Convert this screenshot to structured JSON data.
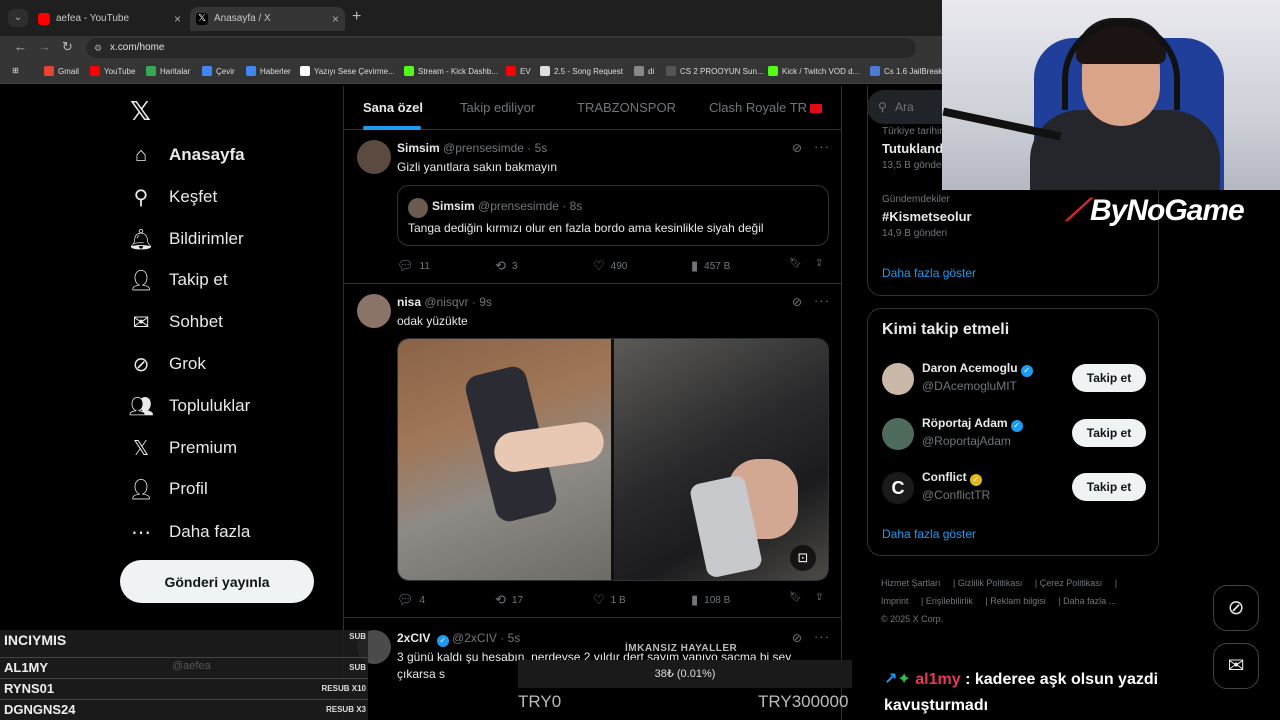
{
  "browser": {
    "tabs": [
      {
        "title": "aefea - YouTube"
      },
      {
        "title": "Anasayfa / X"
      }
    ],
    "url": "x.com/home",
    "bookmarks": [
      "Gmail",
      "YouTube",
      "Haritalar",
      "Çevir",
      "Haberler",
      "Yazıyı Sese Çevirme...",
      "Stream - Kick Dashb...",
      "EV",
      "2.5 - Song Request",
      "di",
      "CS 2 PROOYUN Sun...",
      "Kick / Twitch VOD d...",
      "Cs 1.6 JailBreak"
    ]
  },
  "nav": {
    "items": [
      {
        "label": "Anasayfa",
        "icon": "home-icon"
      },
      {
        "label": "Keşfet",
        "icon": "search-icon"
      },
      {
        "label": "Bildirimler",
        "icon": "bell-icon"
      },
      {
        "label": "Takip et",
        "icon": "add-person-icon"
      },
      {
        "label": "Sohbet",
        "icon": "mail-icon"
      },
      {
        "label": "Grok",
        "icon": "grok-icon"
      },
      {
        "label": "Topluluklar",
        "icon": "communities-icon"
      },
      {
        "label": "Premium",
        "icon": "x-icon"
      },
      {
        "label": "Profil",
        "icon": "person-icon"
      },
      {
        "label": "Daha fazla",
        "icon": "more-circle-icon"
      }
    ],
    "post_button": "Gönderi yayınla"
  },
  "timeline": {
    "tabs": [
      "Sana özel",
      "Takip ediliyor",
      "TRABZONSPOR",
      "Clash Royale TR"
    ],
    "posts": [
      {
        "name": "Simsim",
        "handle": "@prensesimde",
        "time": "5s",
        "text": "Gizli yanıtlara sakın bakmayın",
        "quote": {
          "name": "Simsim",
          "handle": "@prensesimde",
          "time": "8s",
          "text": "Tanga dediğin kırmızı olur en fazla bordo ama kesinlikle siyah değil"
        },
        "replies": "11",
        "reposts": "3",
        "likes": "490",
        "views": "457 B"
      },
      {
        "name": "nisa",
        "handle": "@nisqvr",
        "time": "9s",
        "text": "odak yüzükte",
        "replies": "4",
        "reposts": "17",
        "likes": "1 B",
        "views": "108 B"
      },
      {
        "name": "2xCIV",
        "handle": "@2xCIV",
        "time": "5s",
        "text": "3 günü kaldı şu hesabın, nerdeyse 2 yıldır dert sayım yapıyo saçma bi şey",
        "text2": "çıkarsa s"
      }
    ]
  },
  "sidebar": {
    "search_placeholder": "Ara",
    "trends": [
      {
        "meta": "Türkiye tarihinde gündemde",
        "name": "Tutukland",
        "count": "13,5 B gönderi"
      },
      {
        "meta": "Gündemdekiler",
        "name": "#Kismetseolur",
        "count": "14,9 B gönderi"
      }
    ],
    "show_more": "Daha fazla göster",
    "who_to_follow": {
      "title": "Kimi takip etmeli",
      "users": [
        {
          "name": "Daron Acemoglu",
          "handle": "@DAcemogluMIT",
          "badge": "blue"
        },
        {
          "name": "Röportaj Adam",
          "handle": "@RoportajAdam",
          "badge": "blue"
        },
        {
          "name": "Conflict",
          "handle": "@ConflictTR",
          "badge": "gold"
        }
      ],
      "follow_label": "Takip et",
      "show_more": "Daha fazla göster"
    },
    "footer": [
      "Hizmet Şartları",
      "Gizlilik Politikası",
      "Çerez Politikası",
      "Imprint",
      "Erişilebilirlik",
      "Reklam bilgisi",
      "Daha fazla ...",
      "© 2025 X Corp."
    ]
  },
  "stream": {
    "brand": "ByNoGame",
    "subs": [
      {
        "name": "INCIYMIS",
        "badge": "SUB"
      },
      {
        "name": "AL1MY",
        "badge": "SUB"
      },
      {
        "name": "RYNS01",
        "badge": "RESUB X10"
      },
      {
        "name": "DGNGNS24",
        "badge": "RESUB X3"
      }
    ],
    "ghost_handle": "@aefea",
    "goal": {
      "title": "İMKANSIZ HAYALLER",
      "progress": "38₺ (0.01%)",
      "min": "TRY0",
      "max": "TRY300000"
    },
    "chat": {
      "user": "al1my",
      "message": ": kaderee aşk olsun yazdi kavuşturmadı"
    }
  }
}
